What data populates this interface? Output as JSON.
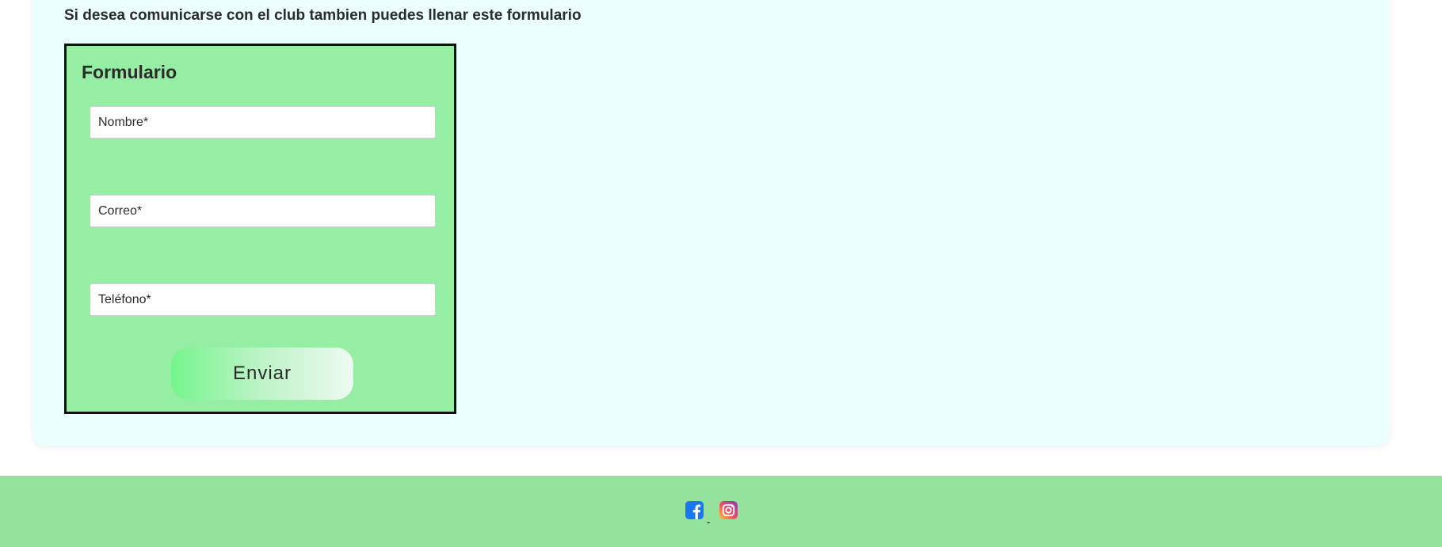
{
  "contact_section": {
    "intro": "Si desea comunicarse con el club tambien puedes llenar este formulario"
  },
  "form": {
    "title": "Formulario",
    "fields": {
      "name": {
        "placeholder": "Nombre*"
      },
      "email": {
        "placeholder": "Correo*"
      },
      "phone": {
        "placeholder": "Teléfono*"
      }
    },
    "submit_label": "Enviar"
  },
  "footer": {
    "social": [
      {
        "icon": "facebook-icon",
        "color": "#1877f2"
      },
      {
        "icon": "instagram-icon",
        "color": "#e1306c"
      }
    ],
    "text": "-"
  },
  "colors": {
    "card_background": "#ecffff",
    "form_background": "#96eda4",
    "footer_background": "#94e29c",
    "button_gradient_start": "#74f58c",
    "button_gradient_end": "#eefaf2"
  }
}
